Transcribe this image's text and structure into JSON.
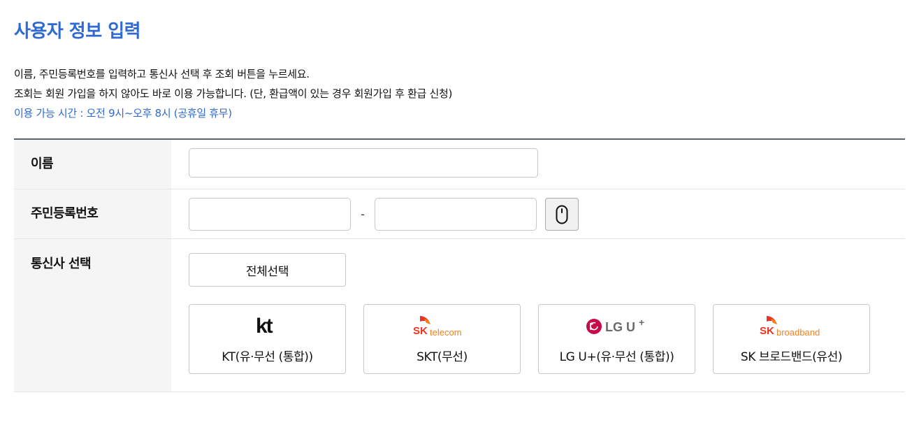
{
  "page": {
    "title": "사용자 정보 입력"
  },
  "intro": {
    "line1": "이름, 주민등록번호를 입력하고 통신사 선택 후 조회 버튼을 누르세요.",
    "line2": "조회는 회원 가입을 하지 않아도 바로 이용 가능합니다. (단, 환급액이 있는 경우 회원가입 후 환급 신청)",
    "line3": "이용 가능 시간 : 오전 9시~오후 8시 (공휴일 휴무)"
  },
  "form": {
    "name": {
      "label": "이름",
      "value": "",
      "placeholder": ""
    },
    "rrn": {
      "label": "주민등록번호",
      "front_value": "",
      "back_value": "",
      "separator": "-",
      "keypad_icon": "mouse-icon"
    },
    "carrier": {
      "label": "통신사 선택",
      "select_all_label": "전체선택",
      "options": [
        {
          "label": "KT(유·무선 (통합))",
          "logo_text": "kt",
          "logo": "kt-logo"
        },
        {
          "label": "SKT(무선)",
          "logo_text": "SK telecom",
          "logo": "sk-telecom-logo"
        },
        {
          "label": "LG U+(유·무선 (통합))",
          "logo_text": "LG U+",
          "logo": "lg-uplus-logo"
        },
        {
          "label": "SK 브로드밴드(유선)",
          "logo_text": "SK broadband",
          "logo": "sk-broadband-logo"
        }
      ]
    }
  },
  "colors": {
    "accent": "#2f6ad2",
    "header_bg": "#f5f5f5",
    "table_top_border": "#5a6470",
    "sk_red": "#e8331f",
    "sk_orange": "#f58220",
    "lg_magenta": "#c70a4c",
    "lg_gray": "#6b6b6b"
  }
}
